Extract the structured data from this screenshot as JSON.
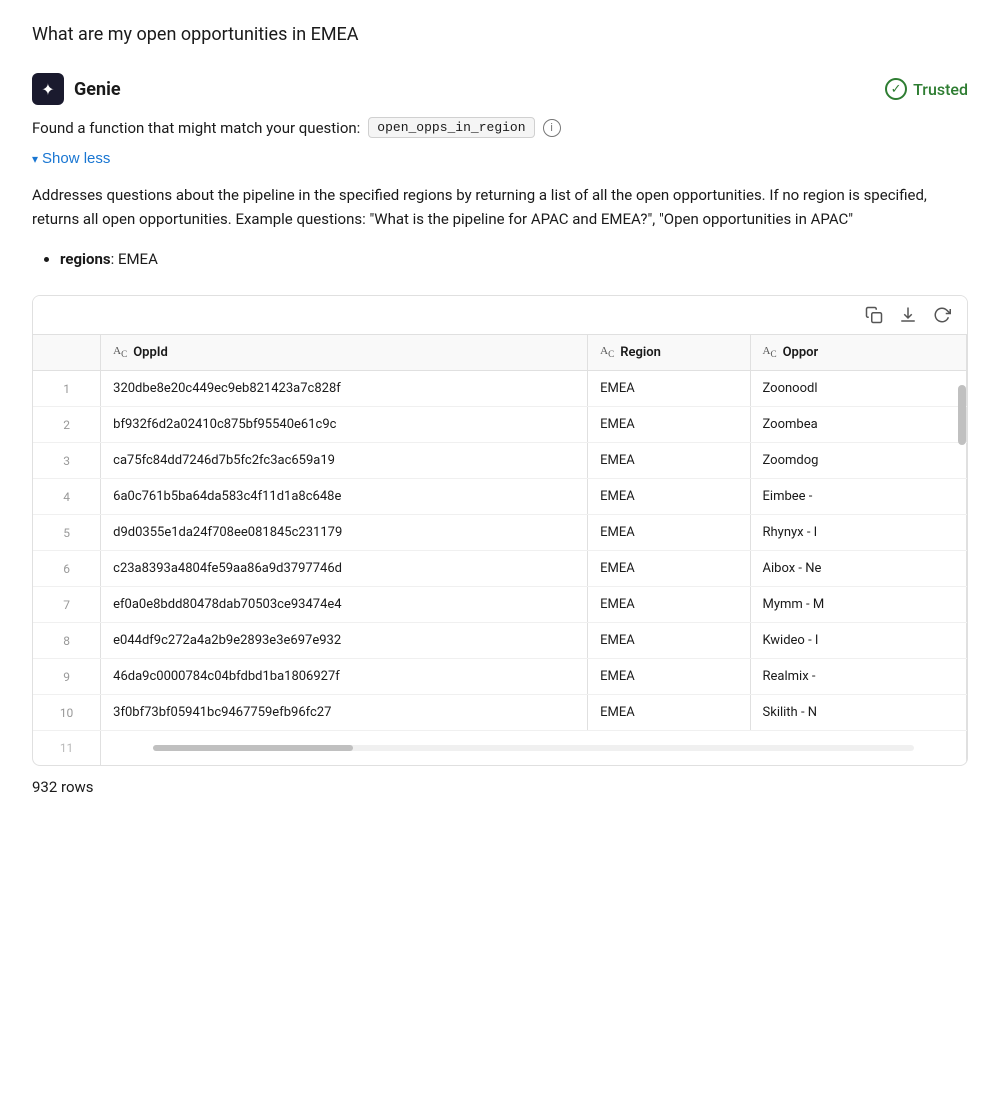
{
  "page": {
    "question": "What are my open opportunities in EMEA"
  },
  "genie": {
    "name": "Genie",
    "icon": "✦",
    "trusted_label": "Trusted",
    "found_function_text": "Found a function that might match your question:",
    "function_name": "open_opps_in_region",
    "show_less_label": "Show less",
    "description": "Addresses questions about the pipeline in the specified regions by returning a list of all the open opportunities. If no region is specified, returns all open opportunities. Example questions: \"What is the pipeline for APAC and EMEA?\", \"Open opportunities in APAC\"",
    "params_label": "regions",
    "params_value": "EMEA"
  },
  "toolbar": {
    "copy_icon": "⧉",
    "download_icon": "↓",
    "refresh_icon": "↺"
  },
  "table": {
    "columns": [
      {
        "id": "row_num",
        "label": "",
        "type": ""
      },
      {
        "id": "oppid",
        "label": "OppId",
        "type": "ABC"
      },
      {
        "id": "region",
        "label": "Region",
        "type": "ABC"
      },
      {
        "id": "opport",
        "label": "Oppor",
        "type": "ABC"
      }
    ],
    "rows": [
      {
        "num": "1",
        "oppid": "320dbe8e20c449ec9eb821423a7c828f",
        "region": "EMEA",
        "opport": "Zoonoodl"
      },
      {
        "num": "2",
        "oppid": "bf932f6d2a02410c875bf95540e61c9c",
        "region": "EMEA",
        "opport": "Zoombea"
      },
      {
        "num": "3",
        "oppid": "ca75fc84dd7246d7b5fc2fc3ac659a19",
        "region": "EMEA",
        "opport": "Zoomdog"
      },
      {
        "num": "4",
        "oppid": "6a0c761b5ba64da583c4f11d1a8c648e",
        "region": "EMEA",
        "opport": "Eimbee -"
      },
      {
        "num": "5",
        "oppid": "d9d0355e1da24f708ee081845c231179",
        "region": "EMEA",
        "opport": "Rhynyx - I"
      },
      {
        "num": "6",
        "oppid": "c23a8393a4804fe59aa86a9d3797746d",
        "region": "EMEA",
        "opport": "Aibox - Ne"
      },
      {
        "num": "7",
        "oppid": "ef0a0e8bdd80478dab70503ce93474e4",
        "region": "EMEA",
        "opport": "Mymm - M"
      },
      {
        "num": "8",
        "oppid": "e044df9c272a4a2b9e2893e3e697e932",
        "region": "EMEA",
        "opport": "Kwideo - I"
      },
      {
        "num": "9",
        "oppid": "46da9c0000784c04bfdbd1ba1806927f",
        "region": "EMEA",
        "opport": "Realmix -"
      },
      {
        "num": "10",
        "oppid": "3f0bf73bf05941bc9467759efb96fc27",
        "region": "EMEA",
        "opport": "Skilith - N"
      },
      {
        "num": "11",
        "oppid": "",
        "region": "",
        "opport": ""
      }
    ],
    "rows_count": "932 rows"
  }
}
